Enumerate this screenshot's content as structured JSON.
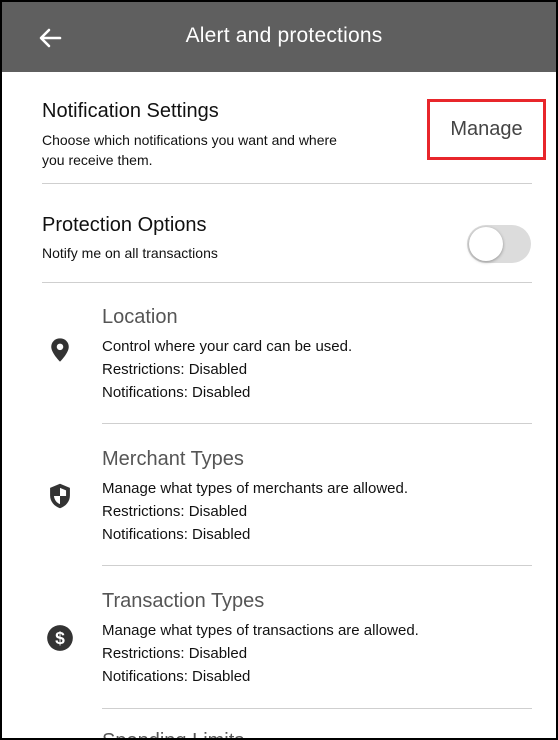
{
  "header": {
    "back_icon": "arrow-left-icon",
    "title": "Alert and protections",
    "bg_color": "#5f5f5f"
  },
  "notification_settings": {
    "title": "Notification Settings",
    "description_line1": "Choose which notifications you want and where",
    "description_line2": "you receive them.",
    "manage_label": "Manage",
    "highlight_color": "#e8262b"
  },
  "protection_options": {
    "title": "Protection Options",
    "description": "Notify me on all transactions",
    "toggle_on": false
  },
  "features": [
    {
      "icon": "location-pin-icon",
      "title": "Location",
      "description": "Control where your card can be used.",
      "restrictions": "Restrictions: Disabled",
      "notifications": "Notifications: Disabled"
    },
    {
      "icon": "shield-icon",
      "title": "Merchant Types",
      "description": "Manage what types of merchants are allowed.",
      "restrictions": "Restrictions: Disabled",
      "notifications": "Notifications: Disabled"
    },
    {
      "icon": "dollar-circle-icon",
      "title": "Transaction Types",
      "description": "Manage what types of transactions are allowed.",
      "restrictions": "Restrictions: Disabled",
      "notifications": "Notifications: Disabled"
    },
    {
      "title": "Spending Limits"
    }
  ]
}
